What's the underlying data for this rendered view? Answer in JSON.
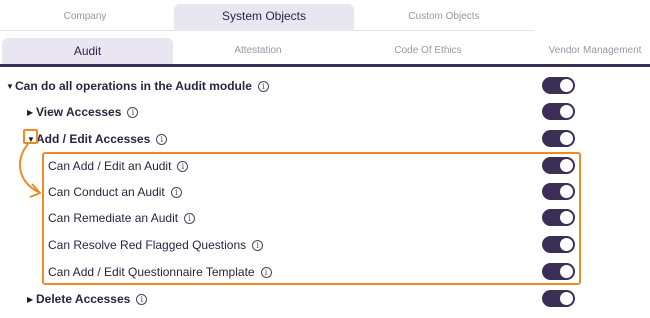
{
  "top_tabs": [
    {
      "label": "Company",
      "active": false
    },
    {
      "label": "System Objects",
      "active": true
    },
    {
      "label": "Custom Objects",
      "active": false
    }
  ],
  "sub_tabs": [
    {
      "label": "Audit",
      "active": true
    },
    {
      "label": "Attestation",
      "active": false
    },
    {
      "label": "Code Of Ethics",
      "active": false
    },
    {
      "label": "Vendor Management",
      "active": false
    }
  ],
  "permissions": {
    "module": {
      "label": "Can do all operations in the Audit module",
      "expanded": true,
      "enabled": true
    },
    "view": {
      "label": "View Accesses",
      "expanded": false,
      "enabled": true
    },
    "add_edit": {
      "label": "Add / Edit Accesses",
      "expanded": true,
      "enabled": true
    },
    "items": [
      {
        "label": "Can Add / Edit an Audit",
        "enabled": true
      },
      {
        "label": "Can Conduct an Audit",
        "enabled": true
      },
      {
        "label": "Can Remediate an Audit",
        "enabled": true
      },
      {
        "label": "Can Resolve Red Flagged Questions",
        "enabled": true
      },
      {
        "label": "Can Add / Edit Questionnaire Template",
        "enabled": true
      }
    ],
    "delete": {
      "label": "Delete Accesses",
      "expanded": false,
      "enabled": true
    }
  },
  "icons": {
    "caret_down": "▼",
    "caret_right": "▶",
    "info": "i"
  },
  "colors": {
    "accent": "#3b2f57",
    "active_tab_bg": "#e9e6f2",
    "highlight": "#f08a24"
  }
}
